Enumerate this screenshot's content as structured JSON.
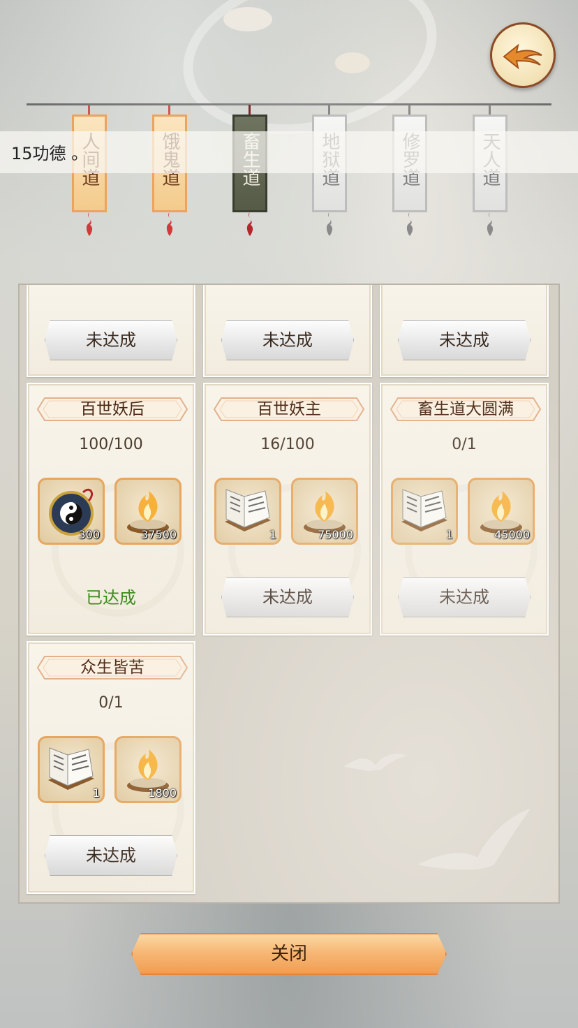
{
  "merit": "15功德 。",
  "tabs": [
    {
      "label": "人间道",
      "state": "orange"
    },
    {
      "label": "饿鬼道",
      "state": "orange"
    },
    {
      "label": "畜生道",
      "state": "selected"
    },
    {
      "label": "地狱道",
      "state": "locked"
    },
    {
      "label": "修罗道",
      "state": "locked"
    },
    {
      "label": "天人道",
      "state": "locked"
    }
  ],
  "top_row_buttons": [
    "未达成",
    "未达成",
    "未达成"
  ],
  "achievements": [
    {
      "title": "百世妖后",
      "progress": "100/100",
      "rewards": [
        {
          "icon": "bagua-compass-icon",
          "count": "300"
        },
        {
          "icon": "spirit-fire-icon",
          "count": "37500"
        }
      ],
      "status": "已达成"
    },
    {
      "title": "百世妖主",
      "progress": "16/100",
      "rewards": [
        {
          "icon": "scroll-book-icon",
          "count": "1"
        },
        {
          "icon": "spirit-fire-icon",
          "count": "75000"
        }
      ],
      "status": "未达成"
    },
    {
      "title": "畜生道大圆满",
      "progress": "0/1",
      "rewards": [
        {
          "icon": "scroll-book-icon",
          "count": "1"
        },
        {
          "icon": "spirit-fire-icon",
          "count": "45000"
        }
      ],
      "status": "未达成"
    },
    {
      "title": "众生皆苦",
      "progress": "0/1",
      "rewards": [
        {
          "icon": "scroll-book-icon",
          "count": "1"
        },
        {
          "icon": "spirit-fire-icon",
          "count": "1800"
        }
      ],
      "status": "未达成"
    }
  ],
  "close_label": "关闭",
  "colors": {
    "accent": "#f19d52",
    "achieved": "#3c8a1e",
    "title_text": "#4d2a16"
  }
}
